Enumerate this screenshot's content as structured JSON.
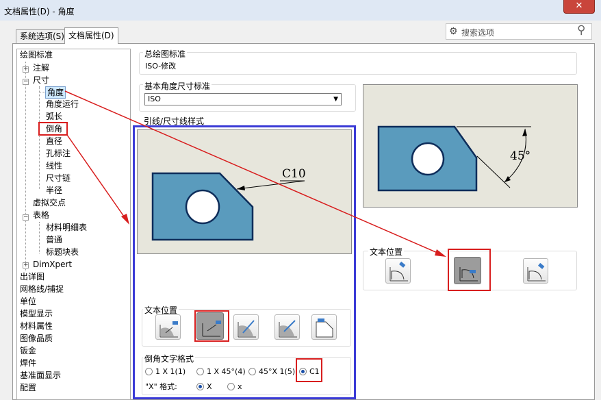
{
  "window": {
    "title": "文档属性(D) - 角度",
    "close": "✕"
  },
  "tabs": [
    {
      "label": "系统选项(S)"
    },
    {
      "label": "文档属性(D)"
    }
  ],
  "search": {
    "placeholder": "搜索选项"
  },
  "tree": [
    {
      "label": "绘图标准"
    },
    {
      "label": "注解"
    },
    {
      "label": "尺寸"
    },
    {
      "label": "角度"
    },
    {
      "label": "角度运行"
    },
    {
      "label": "弧长"
    },
    {
      "label": "倒角"
    },
    {
      "label": "直径"
    },
    {
      "label": "孔标注"
    },
    {
      "label": "线性"
    },
    {
      "label": "尺寸链"
    },
    {
      "label": "半径"
    },
    {
      "label": "虚拟交点"
    },
    {
      "label": "表格"
    },
    {
      "label": "材料明细表"
    },
    {
      "label": "普通"
    },
    {
      "label": "标题块表"
    },
    {
      "label": "DimXpert"
    },
    {
      "label": "出详图"
    },
    {
      "label": "网格线/捕捉"
    },
    {
      "label": "单位"
    },
    {
      "label": "模型显示"
    },
    {
      "label": "材料属性"
    },
    {
      "label": "图像品质"
    },
    {
      "label": "钣金"
    },
    {
      "label": "焊件"
    },
    {
      "label": "基准面显示"
    },
    {
      "label": "配置"
    }
  ],
  "overall_standard": {
    "label": "总绘图标准",
    "value": "ISO-修改"
  },
  "base_standard": {
    "label": "基本角度尺寸标准",
    "value": "ISO"
  },
  "leader_style": {
    "label": "引线/尺寸线样式"
  },
  "chamfer_preview": {
    "text": "C10"
  },
  "angle_preview": {
    "text": "45°"
  },
  "chamfer_text_position": {
    "label": "文本位置"
  },
  "chamfer_format": {
    "label": "倒角文字格式",
    "options": [
      "1 X 1(1)",
      "1 X 45°(4)",
      "45°X 1(5)",
      "C1"
    ],
    "selected": "C1",
    "x_label": "\"X\" 格式:",
    "x_options": [
      "X",
      "x"
    ],
    "x_selected": "X"
  },
  "angle_text_position": {
    "label": "文本位置"
  },
  "colors": {
    "accent_red": "#d81e1e",
    "accent_blue": "#3b3bd6",
    "part_fill": "#5a9bbd"
  }
}
